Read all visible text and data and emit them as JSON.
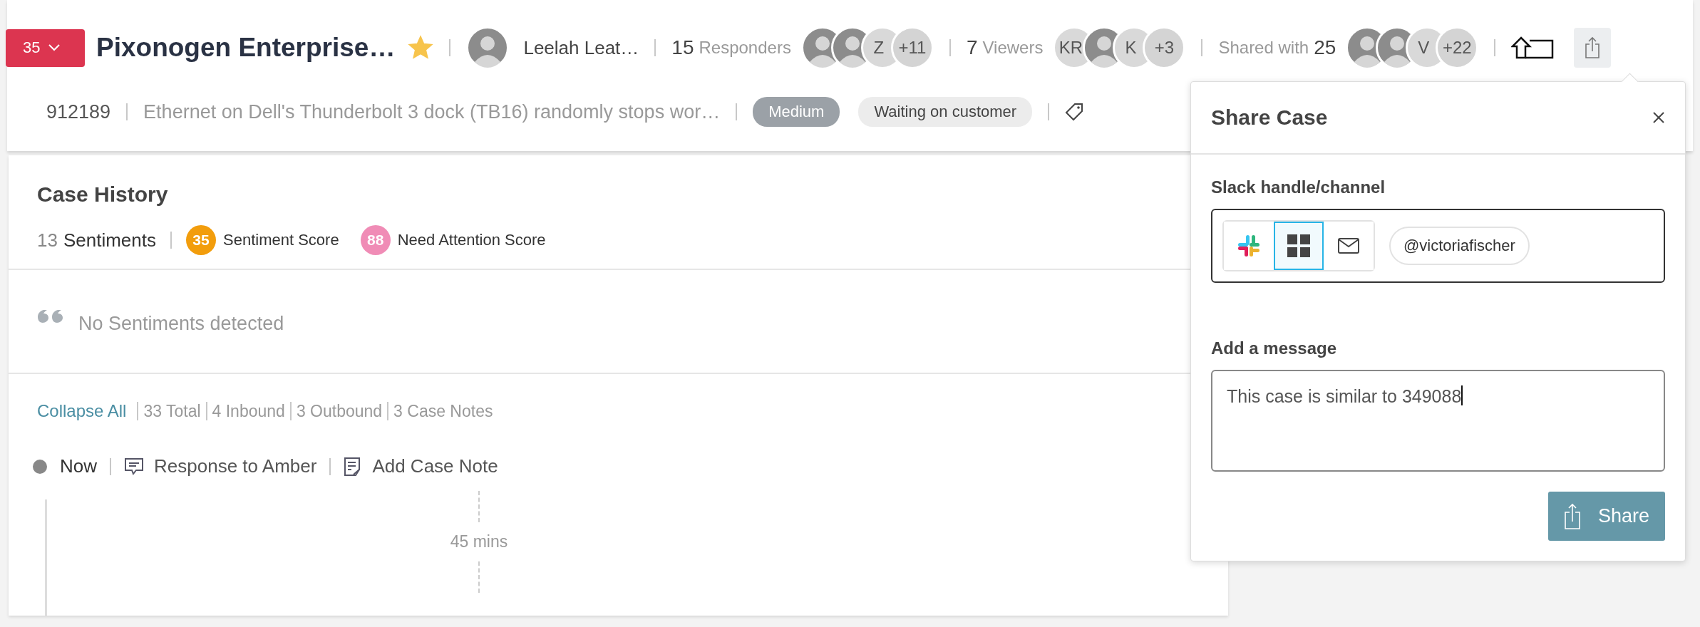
{
  "header": {
    "count_badge": "35",
    "title": "Pixonogen Enterprise…",
    "starred": true,
    "owner": {
      "name": "Leelah Leat…"
    },
    "groups": [
      {
        "count": "15",
        "label": "Responders",
        "kind": "count_first",
        "avatars": [
          {
            "kind": "photo"
          },
          {
            "kind": "photo"
          },
          {
            "kind": "initials",
            "text": "Z"
          },
          {
            "kind": "more",
            "text": "+11"
          }
        ]
      },
      {
        "count": "7",
        "label": "Viewers",
        "kind": "count_first",
        "avatars": [
          {
            "kind": "initials",
            "text": "KR"
          },
          {
            "kind": "photo"
          },
          {
            "kind": "initials",
            "text": "K"
          },
          {
            "kind": "more",
            "text": "+3"
          }
        ]
      },
      {
        "count": "25",
        "label": "Shared with",
        "kind": "label_first",
        "avatars": [
          {
            "kind": "photo"
          },
          {
            "kind": "photo"
          },
          {
            "kind": "initials",
            "text": "V"
          },
          {
            "kind": "more",
            "text": "+22"
          }
        ]
      }
    ]
  },
  "case_line": {
    "id": "912189",
    "subject": "Ethernet on Dell's Thunderbolt 3 dock (TB16) randomly stops wor…",
    "priority": "Medium",
    "status": "Waiting on customer"
  },
  "case_history": {
    "title": "Case History",
    "sentiments_count": "13",
    "sentiments_label": "Sentiments",
    "scores": [
      {
        "score": "35",
        "name": "Sentiment Score",
        "color": "#f29d0c"
      },
      {
        "score": "88",
        "name": "Need Attention Score",
        "color": "#f08cb6"
      }
    ],
    "empty_text": "No Sentiments detected"
  },
  "timeline": {
    "collapse_link": "Collapse All",
    "stats": [
      "33 Total",
      "4 Inbound",
      "3 Outbound",
      "3 Case Notes"
    ],
    "now_label": "Now",
    "actions": [
      {
        "kind": "response",
        "label": "Response to Amber"
      },
      {
        "kind": "note",
        "label": "Add Case Note"
      }
    ],
    "gap": "45 mins"
  },
  "share_panel": {
    "title": "Share Case",
    "channel_label": "Slack handle/channel",
    "channels": [
      {
        "kind": "slack",
        "selected": false
      },
      {
        "kind": "grid",
        "selected": true
      },
      {
        "kind": "email",
        "selected": false
      }
    ],
    "recipients": [
      "@victoriafischer"
    ],
    "message_label": "Add a message",
    "message": "This case is similar to 349088",
    "button": "Share"
  }
}
